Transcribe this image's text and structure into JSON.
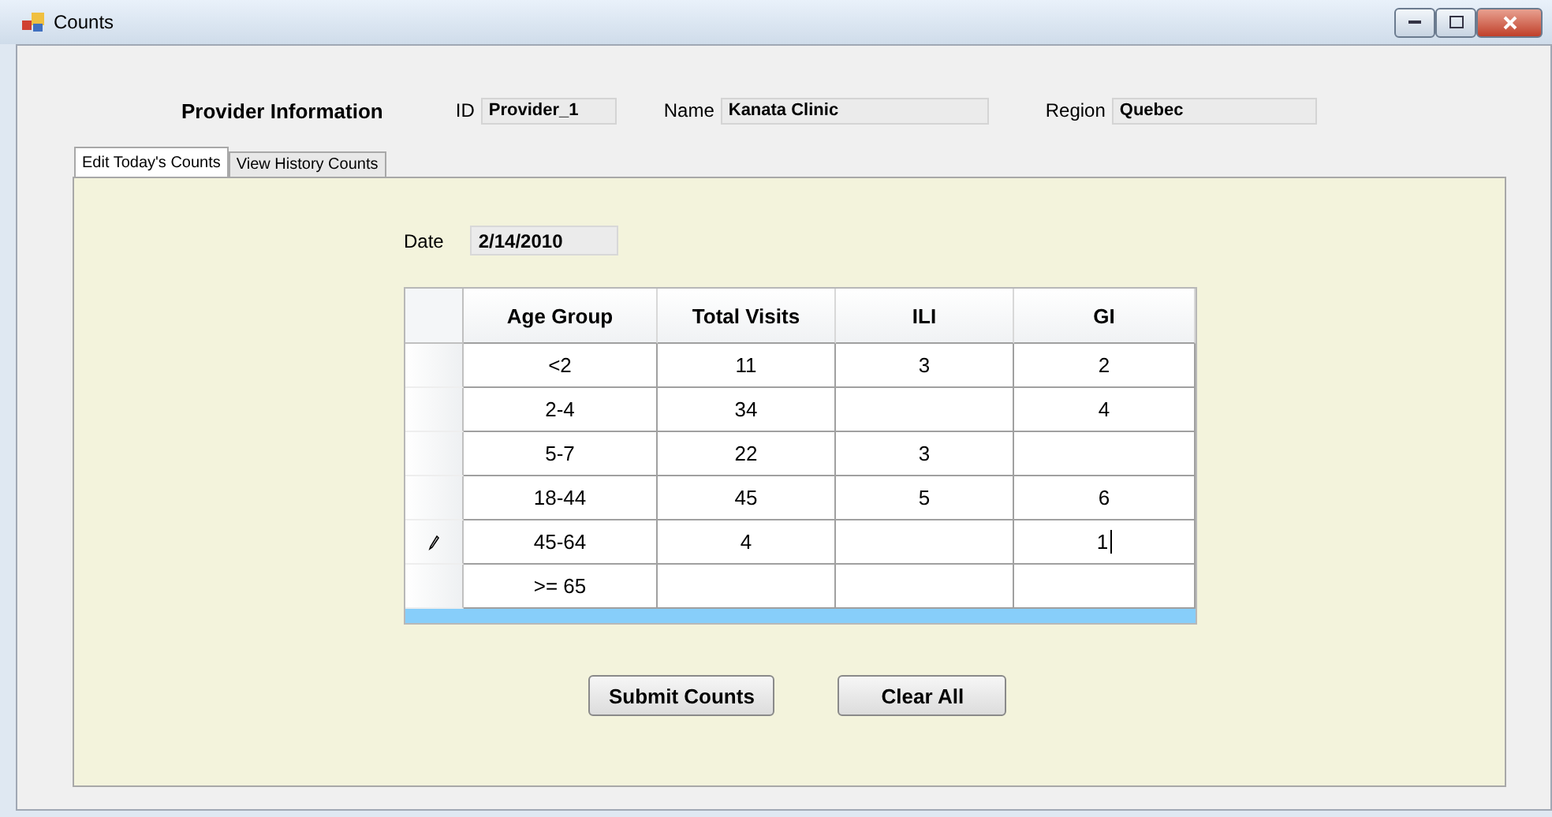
{
  "window": {
    "title": "Counts"
  },
  "provider": {
    "heading": "Provider Information",
    "fields": [
      {
        "label": "ID",
        "value": "Provider_1"
      },
      {
        "label": "Name",
        "value": "Kanata Clinic"
      },
      {
        "label": "Region",
        "value": "Quebec"
      }
    ]
  },
  "tabs": [
    {
      "label": "Edit Today's Counts",
      "selected": true
    },
    {
      "label": "View History Counts",
      "selected": false
    }
  ],
  "date": {
    "label": "Date",
    "value": "2/14/2010"
  },
  "table": {
    "columns": [
      "Age Group",
      "Total Visits",
      "ILI",
      "GI"
    ],
    "rows": [
      {
        "cells": [
          "<2",
          "11",
          "3",
          "2"
        ],
        "editing": false
      },
      {
        "cells": [
          "2-4",
          "34",
          "",
          "4"
        ],
        "editing": false
      },
      {
        "cells": [
          "5-7",
          "22",
          "3",
          ""
        ],
        "editing": false
      },
      {
        "cells": [
          "18-44",
          "45",
          "5",
          "6"
        ],
        "editing": false
      },
      {
        "cells": [
          "45-64",
          "4",
          "",
          "1"
        ],
        "editing": true
      },
      {
        "cells": [
          ">= 65",
          "",
          "",
          ""
        ],
        "editing": false
      }
    ]
  },
  "buttons": [
    "Submit Counts",
    "Clear All"
  ]
}
